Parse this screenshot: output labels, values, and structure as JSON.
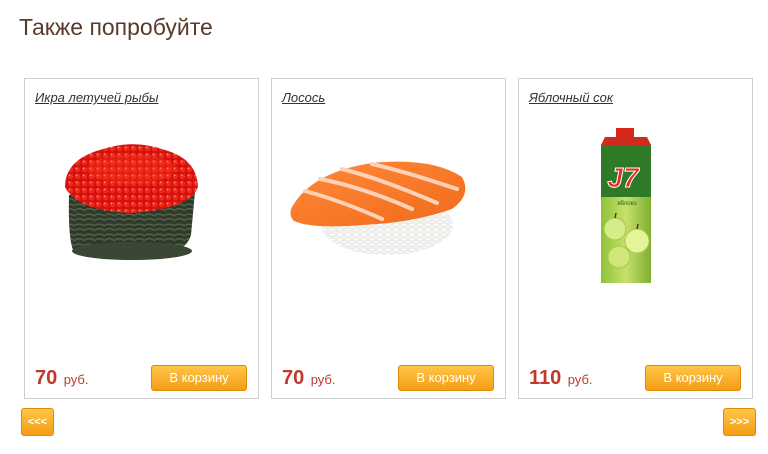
{
  "section": {
    "title": "Также попробуйте"
  },
  "products": [
    {
      "name": "Икра летучей рыбы",
      "price": "70",
      "currency": "руб.",
      "button": "В корзину",
      "image": "tobiko-gunkan-image"
    },
    {
      "name": "Лосось",
      "price": "70",
      "currency": "руб.",
      "button": "В корзину",
      "image": "salmon-nigiri-image"
    },
    {
      "name": "Яблочный сок",
      "price": "110",
      "currency": "руб.",
      "button": "В корзину",
      "image": "j7-apple-juice-carton-image"
    }
  ],
  "pagination": {
    "prev_label": "<<<",
    "next_label": ">>>"
  },
  "colors": {
    "accent": "#f59d14",
    "price": "#c0392b",
    "title": "#5a3a2a"
  },
  "logo_text": {
    "juice_brand": "J7",
    "juice_flavor": "Яблоко"
  }
}
